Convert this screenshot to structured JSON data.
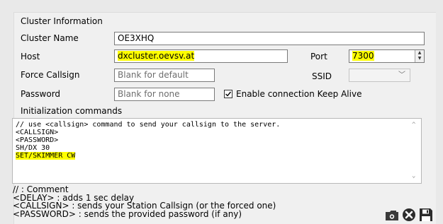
{
  "section_title": "Cluster Information",
  "fields": {
    "cluster_name_label": "Cluster Name",
    "cluster_name_value": "OE3XHQ",
    "host_label": "Host",
    "host_value": "dxcluster.oevsv.at",
    "port_label": "Port",
    "port_value": "7300",
    "force_callsign_label": "Force Callsign",
    "force_callsign_placeholder": "Blank for default",
    "ssid_label": "SSID",
    "ssid_value": "",
    "password_label": "Password",
    "password_placeholder": "Blank for none",
    "keep_alive_label": "Enable connection Keep Alive",
    "keep_alive_checked": true,
    "init_commands_label": "Initialization commands"
  },
  "init_commands": [
    "// use <callsign> command to send your callsign to the server.",
    "<CALLSIGN>",
    "<PASSWORD>",
    "SH/DX 30",
    "SET/SKIMMER CW"
  ],
  "help_lines": [
    "// : Comment",
    "<DELAY> : adds 1 sec delay",
    "<CALLSIGN> : sends your Station Callsign (or the forced one)",
    "<PASSWORD> : sends the provided password (if any)"
  ],
  "highlight_color": "#ffff00",
  "icons": [
    "folder-icon",
    "delete-icon",
    "save-icon"
  ]
}
